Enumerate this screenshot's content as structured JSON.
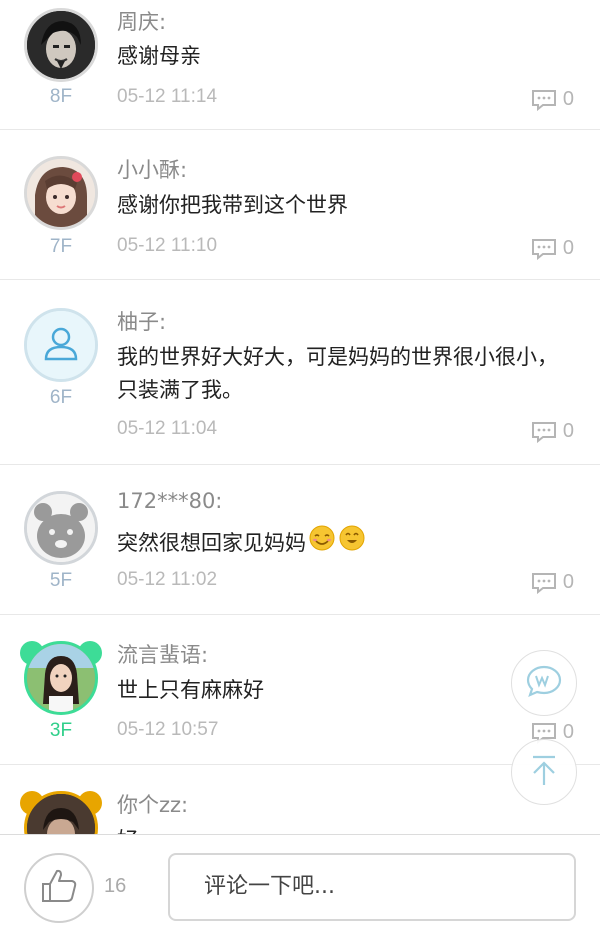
{
  "comments": [
    {
      "name": "周庆:",
      "content": "感谢母亲",
      "floor": "8F",
      "time": "05-12 11:14",
      "reply_count": "0"
    },
    {
      "name": "小小酥:",
      "content": "感谢你把我带到这个世界",
      "floor": "7F",
      "time": "05-12 11:10",
      "reply_count": "0"
    },
    {
      "name": "柚子:",
      "content": "我的世界好大好大，可是妈妈的世界很小很小，只装满了我。",
      "floor": "6F",
      "time": "05-12 11:04",
      "reply_count": "0"
    },
    {
      "name": "172***80:",
      "content": "突然很想回家见妈妈",
      "floor": "5F",
      "time": "05-12 11:02",
      "reply_count": "0"
    },
    {
      "name": "流言蜚语:",
      "content": "世上只有麻麻好",
      "floor": "3F",
      "time": "05-12 10:57",
      "reply_count": "0"
    },
    {
      "name": "你个zz:",
      "content": "好"
    }
  ],
  "bottom": {
    "like_count": "16",
    "comment_placeholder": "评论一下吧..."
  },
  "colors": {
    "floor": "#9fb4c8",
    "floor_highlight": "#2fcf8a",
    "badge_ring_green": "#3ddc97",
    "badge_ring_gold": "#e8a500"
  }
}
